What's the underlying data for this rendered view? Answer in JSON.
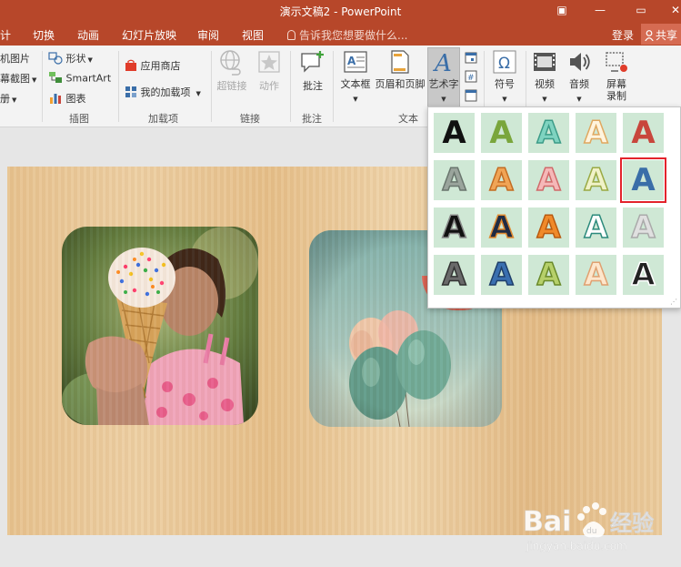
{
  "window": {
    "title": "演示文稿2 - PowerPoint",
    "controls": [
      "▣",
      "—",
      "▭",
      "✕"
    ]
  },
  "tabs": [
    "计",
    "切换",
    "动画",
    "幻灯片放映",
    "审阅",
    "视图"
  ],
  "tell_me": "告诉我您想要做什么...",
  "login": "登录",
  "share": "共享",
  "ribbon": {
    "images_group": {
      "online_pictures": "机图片",
      "screenshot": "幕截图",
      "album": "册"
    },
    "illustrations": {
      "shapes": "形状",
      "smartart": "SmartArt",
      "chart": "图表",
      "group_label": "插图"
    },
    "addins": {
      "store": "应用商店",
      "my_addins": "我的加载项",
      "group_label": "加载项"
    },
    "links": {
      "hyperlink": "超链接",
      "action": "动作",
      "group_label": "链接"
    },
    "comments": {
      "comment": "批注",
      "group_label": "批注"
    },
    "text": {
      "textbox": "文本框",
      "header_footer": "页眉和页脚",
      "wordart": "艺术字",
      "group_label": "文本"
    },
    "symbols": {
      "symbol": "符号"
    },
    "media": {
      "video": "视频",
      "audio": "音频",
      "screen_record_1": "屏幕",
      "screen_record_2": "录制"
    }
  },
  "wordart_gallery": {
    "glyph": "A",
    "rows": [
      [
        {
          "fill": "#111111",
          "stroke": "none"
        },
        {
          "fill": "#7aa63c",
          "stroke": "none"
        },
        {
          "fill": "#7fd3c0",
          "stroke": "#3c9c88"
        },
        {
          "fill": "#fff4de",
          "stroke": "#e0a860"
        },
        {
          "fill": "#c8463c",
          "stroke": "none"
        }
      ],
      [
        {
          "fill": "#9aa49c",
          "stroke": "#6a766e"
        },
        {
          "fill": "#f0a456",
          "stroke": "#c46c22"
        },
        {
          "fill": "#f5b8b8",
          "stroke": "#d06a6a"
        },
        {
          "fill": "#f0f2c8",
          "stroke": "#9aaa44"
        },
        {
          "fill": "#3a6ea8",
          "stroke": "none"
        }
      ],
      [
        {
          "fill": "#111111",
          "stroke": "#888888"
        },
        {
          "fill": "#1f2b44",
          "stroke": "#e08a30"
        },
        {
          "fill": "#f08a2a",
          "stroke": "#b85a10"
        },
        {
          "fill": "#ffffff",
          "stroke": "#2c8a7c"
        },
        {
          "fill": "#e0e0e0",
          "stroke": "#aaaaaa"
        }
      ],
      [
        {
          "fill": "#6a6a6a",
          "stroke": "#333333"
        },
        {
          "fill": "#3a6fb0",
          "stroke": "#1f3f6a"
        },
        {
          "fill": "#b6d06a",
          "stroke": "#6a8a2a"
        },
        {
          "fill": "#fde6cc",
          "stroke": "#e0a070"
        },
        {
          "fill": "#222222",
          "stroke": "#ffffff"
        }
      ]
    ],
    "selected": [
      1,
      4
    ]
  },
  "watermark": {
    "brand": "Bai",
    "paw": "du",
    "cn": "经验",
    "url": "jingyan.baidu.com"
  }
}
